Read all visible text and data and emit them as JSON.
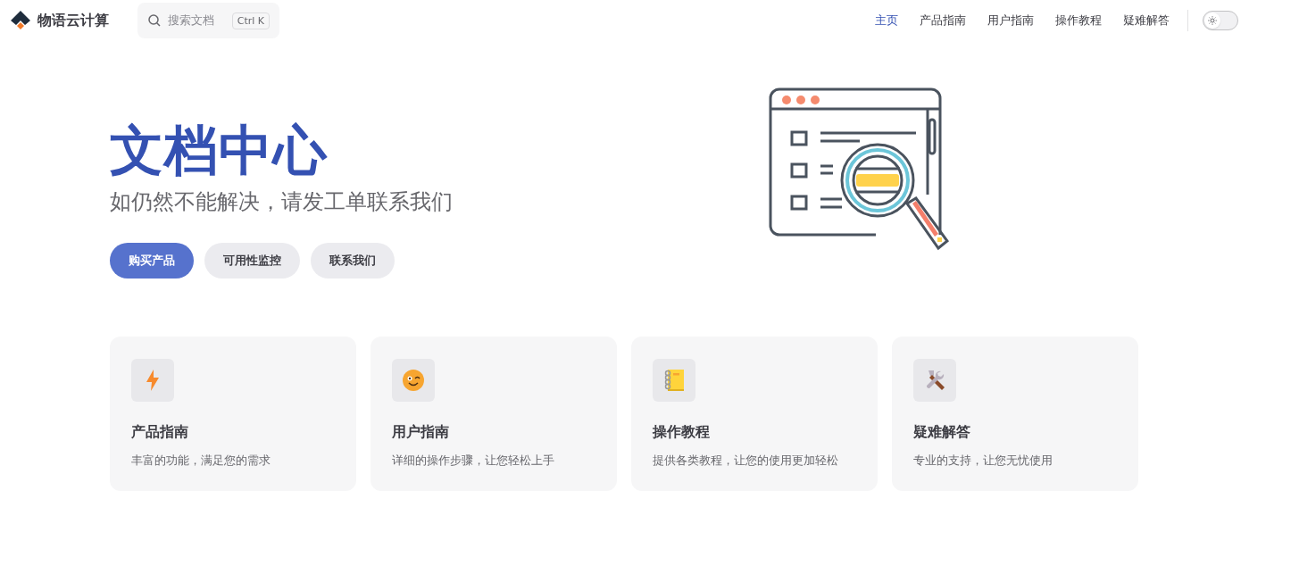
{
  "header": {
    "brand": "物语云计算",
    "search": {
      "placeholder": "搜索文档",
      "shortcut": "Ctrl K"
    },
    "nav": [
      {
        "label": "主页",
        "selected": true
      },
      {
        "label": "产品指南",
        "selected": false
      },
      {
        "label": "用户指南",
        "selected": false
      },
      {
        "label": "操作教程",
        "selected": false
      },
      {
        "label": "疑难解答",
        "selected": false
      }
    ],
    "theme_switch": {
      "on": false
    }
  },
  "hero": {
    "title": "文档中心",
    "subtitle": "如仍然不能解决，请发工单联系我们",
    "buttons": [
      {
        "label": "购买产品",
        "kind": "primary"
      },
      {
        "label": "可用性监控",
        "kind": "secondary"
      },
      {
        "label": "联系我们",
        "kind": "secondary"
      }
    ]
  },
  "features": [
    {
      "kind": "bolt",
      "title": "产品指南",
      "description": "丰富的功能，满足您的需求"
    },
    {
      "kind": "smiley",
      "title": "用户指南",
      "description": "详细的操作步骤，让您轻松上手"
    },
    {
      "kind": "notebook",
      "title": "操作教程",
      "description": "提供各类教程，让您的使用更加轻松"
    },
    {
      "kind": "tools",
      "title": "疑难解答",
      "description": "专业的支持，让您无忧使用"
    }
  ]
}
